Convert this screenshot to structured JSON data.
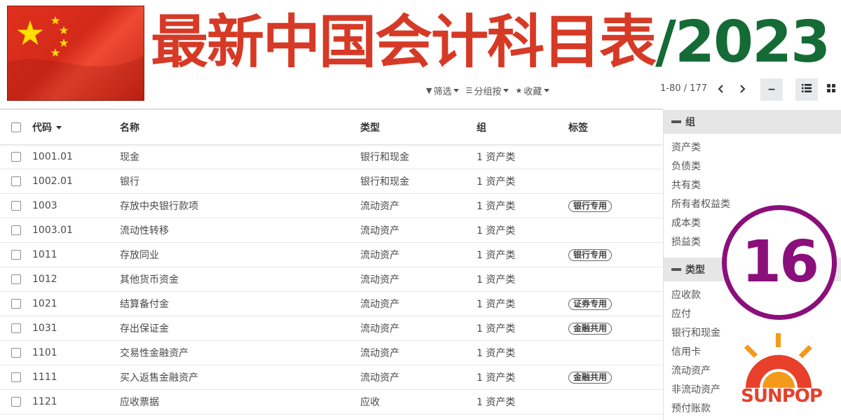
{
  "banner": {
    "title_cn": "最新中国会计科目表",
    "title_year": "/2023"
  },
  "controls": {
    "filter_label": "筛选",
    "groupby_label": "分组按",
    "favorites_label": "收藏",
    "pager_text": "1-80 / 177",
    "prev_label": "‹",
    "next_label": "›",
    "collapse_label": "−",
    "list_view_icon": "list-icon",
    "kanban_view_icon": "grid-icon"
  },
  "table": {
    "headers": {
      "code": "代码",
      "name": "名称",
      "type": "类型",
      "group": "组",
      "tags": "标签"
    },
    "rows": [
      {
        "code": "1001.01",
        "name": "现金",
        "type": "银行和现金",
        "group": "1 资产类",
        "tag": ""
      },
      {
        "code": "1002.01",
        "name": "银行",
        "type": "银行和现金",
        "group": "1 资产类",
        "tag": ""
      },
      {
        "code": "1003",
        "name": "存放中央银行款项",
        "type": "流动资产",
        "group": "1 资产类",
        "tag": "银行专用"
      },
      {
        "code": "1003.01",
        "name": "流动性转移",
        "type": "流动资产",
        "group": "1 资产类",
        "tag": ""
      },
      {
        "code": "1011",
        "name": "存放同业",
        "type": "流动资产",
        "group": "1 资产类",
        "tag": "银行专用"
      },
      {
        "code": "1012",
        "name": "其他货币资金",
        "type": "流动资产",
        "group": "1 资产类",
        "tag": ""
      },
      {
        "code": "1021",
        "name": "结算备付金",
        "type": "流动资产",
        "group": "1 资产类",
        "tag": "证券专用"
      },
      {
        "code": "1031",
        "name": "存出保证金",
        "type": "流动资产",
        "group": "1 资产类",
        "tag": "金融共用"
      },
      {
        "code": "1101",
        "name": "交易性金融资产",
        "type": "流动资产",
        "group": "1 资产类",
        "tag": ""
      },
      {
        "code": "1111",
        "name": "买入返售金融资产",
        "type": "流动资产",
        "group": "1 资产类",
        "tag": "金融共用"
      },
      {
        "code": "1121",
        "name": "应收票据",
        "type": "应收",
        "group": "1 资产类",
        "tag": ""
      }
    ]
  },
  "sidebar": {
    "group_title": "组",
    "group_items": [
      "资产类",
      "负债类",
      "共有类",
      "所有者权益类",
      "成本类",
      "损益类"
    ],
    "type_title": "类型",
    "type_items": [
      "应收款",
      "应付",
      "银行和现金",
      "信用卡",
      "流动资产",
      "非流动资产",
      "预付账款"
    ]
  },
  "overlay": {
    "badge_number": "16",
    "logo_text": "SUNPOP"
  },
  "colors": {
    "banner_red": "#d63a26",
    "banner_green": "#156b35",
    "badge_purple": "#8b0f7a",
    "logo_orange": "#e8402a"
  }
}
